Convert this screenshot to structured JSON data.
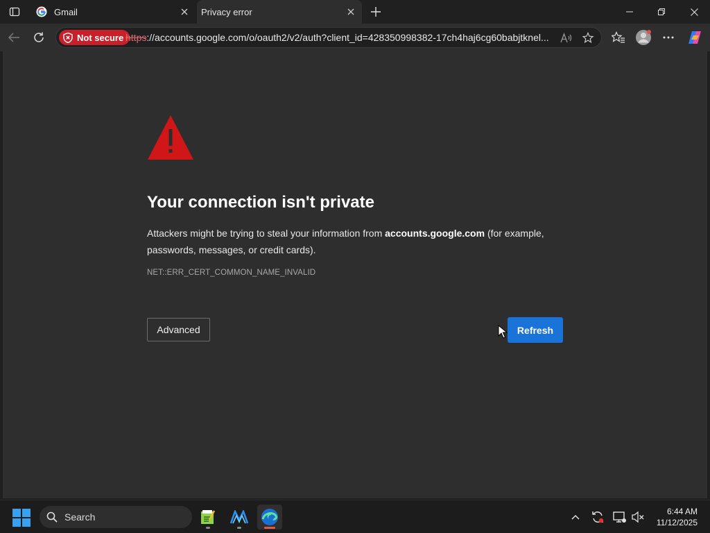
{
  "tabs": [
    {
      "title": "Gmail",
      "favicon": "google-icon"
    },
    {
      "title": "Privacy error",
      "favicon": "none"
    }
  ],
  "toolbar": {
    "security_label": "Not secure",
    "url_scheme": "https",
    "url_rest": "://accounts.google.com/o/oauth2/v2/auth?client_id=428350998382-17ch4haj6cg60babjtknel..."
  },
  "page": {
    "headline": "Your connection isn't private",
    "desc_prefix": "Attackers might be trying to steal your information from ",
    "desc_host": "accounts.google.com",
    "desc_suffix": " (for example, passwords, messages, or credit cards).",
    "error_code": "NET::ERR_CERT_COMMON_NAME_INVALID",
    "advanced_label": "Advanced",
    "refresh_label": "Refresh"
  },
  "taskbar": {
    "search_label": "Search",
    "time": "6:44 AM",
    "date": "11/12/2025"
  },
  "colors": {
    "accent": "#1a73d8",
    "danger": "#c7202a",
    "background": "#2e2e2e"
  }
}
